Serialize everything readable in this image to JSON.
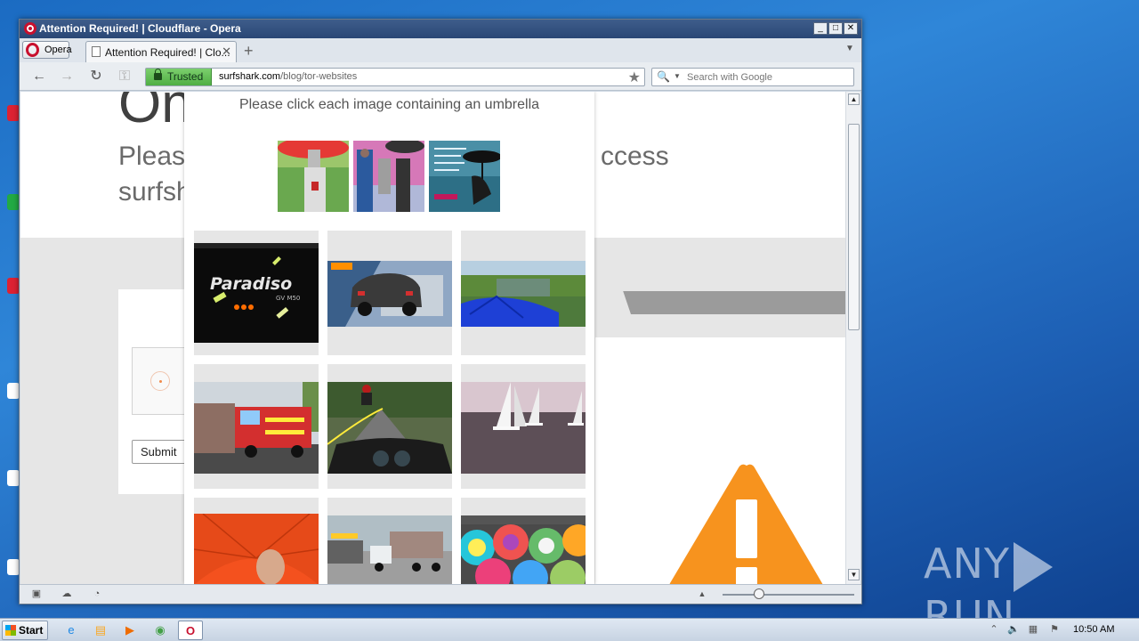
{
  "window": {
    "title": "Attention Required! | Cloudflare - Opera",
    "minimize": "_",
    "maximize": "□",
    "close": "✕"
  },
  "browser": {
    "menu_label": "Opera",
    "tab_label": "Attention Required! | Clo...",
    "tab_close": "✕",
    "new_tab": "+",
    "back": "←",
    "forward": "→",
    "reload": "↻",
    "keys": "⚿",
    "security_badge": "Trusted",
    "url_host": "surfshark.com",
    "url_path": "/blog/tor-websites",
    "bookmark": "★",
    "search_placeholder": "Search with Google"
  },
  "page": {
    "heading_fragment": "On",
    "line1_left": "Pleas",
    "line1_right": "ccess",
    "line2_left": "surfsh",
    "submit_label": "Submit"
  },
  "challenge": {
    "prompt": "Please click each image containing an umbrella",
    "samples": [
      "sample-1",
      "sample-2",
      "sample-3"
    ],
    "tiles": [
      {
        "name": "tile-paradiso",
        "caption": "Paradiso",
        "subcaption": "GV M50"
      },
      {
        "name": "tile-car-road",
        "caption": ""
      },
      {
        "name": "tile-blue-umbrella-river",
        "caption": ""
      },
      {
        "name": "tile-fire-truck",
        "caption": ""
      },
      {
        "name": "tile-motorcycle-road",
        "caption": ""
      },
      {
        "name": "tile-sailboats",
        "caption": ""
      },
      {
        "name": "tile-red-umbrella",
        "caption": ""
      },
      {
        "name": "tile-trucks",
        "caption": ""
      },
      {
        "name": "tile-colorful-umbrellas",
        "caption": ""
      }
    ]
  },
  "statusbar": {
    "zoom_icons": [
      "panel-icon",
      "cloud-icon",
      "speed-icon"
    ]
  },
  "taskbar": {
    "start_label": "Start",
    "clock": "10:50 AM"
  },
  "watermark": {
    "left": "ANY",
    "right": "RUN"
  },
  "colors": {
    "accent_orange": "#f7931e",
    "trusted_green": "#5cb85c",
    "opera_red": "#c8102e"
  }
}
